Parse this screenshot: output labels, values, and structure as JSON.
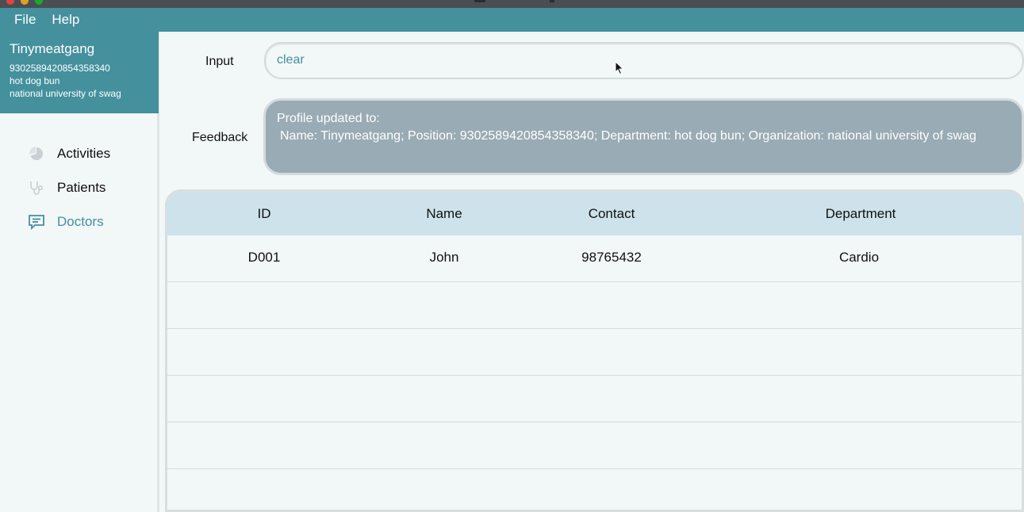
{
  "menubar": {
    "items": [
      "File",
      "Help"
    ]
  },
  "profile": {
    "name": "Tinymeatgang",
    "position": "9302589420854358340",
    "department": "hot dog bun",
    "organization": "national university of swag"
  },
  "nav": {
    "items": [
      {
        "label": "Activities",
        "icon": "pie-chart-icon"
      },
      {
        "label": "Patients",
        "icon": "stethoscope-icon"
      },
      {
        "label": "Doctors",
        "icon": "chat-icon"
      }
    ],
    "active": "Doctors"
  },
  "command": {
    "label": "Input",
    "value": "clear"
  },
  "feedback": {
    "label": "Feedback",
    "line1": "Profile updated to:",
    "line2": "Name: Tinymeatgang; Position: 9302589420854358340; Department: hot dog bun; Organization: national university of swag"
  },
  "table": {
    "columns": [
      "ID",
      "Name",
      "Contact",
      "Department"
    ],
    "rows": [
      [
        "D001",
        "John",
        "98765432",
        "Cardio"
      ],
      [
        "",
        "",
        "",
        ""
      ],
      [
        "",
        "",
        "",
        ""
      ],
      [
        "",
        "",
        "",
        ""
      ],
      [
        "",
        "",
        "",
        ""
      ],
      [
        "",
        "",
        "",
        ""
      ]
    ]
  },
  "colors": {
    "accent": "#44909d",
    "feedback_bg": "#99abb4",
    "table_header_bg": "#cde2ea"
  }
}
